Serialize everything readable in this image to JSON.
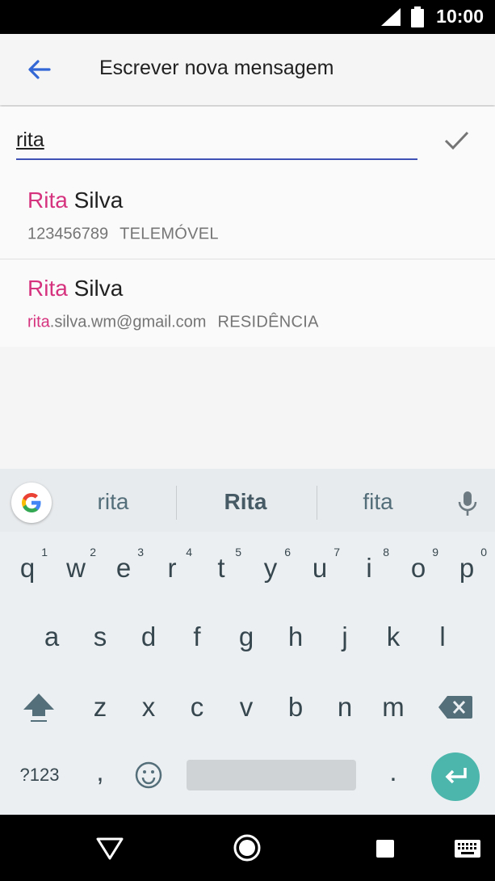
{
  "status": {
    "time": "10:00"
  },
  "app_bar": {
    "title": "Escrever nova mensagem"
  },
  "search": {
    "value": "rita"
  },
  "results": [
    {
      "name_match": "Rita",
      "name_rest": " Silva",
      "detail_match": "",
      "detail_rest": "123456789",
      "type": "TELEMÓVEL"
    },
    {
      "name_match": "Rita",
      "name_rest": " Silva",
      "detail_match": "rita",
      "detail_rest": ".silva.wm@gmail.com",
      "type": "RESIDÊNCIA"
    }
  ],
  "keyboard": {
    "suggestions": [
      "rita",
      "Rita",
      "fita"
    ],
    "row1": [
      "q",
      "w",
      "e",
      "r",
      "t",
      "y",
      "u",
      "i",
      "o",
      "p"
    ],
    "row1_hints": [
      "1",
      "2",
      "3",
      "4",
      "5",
      "6",
      "7",
      "8",
      "9",
      "0"
    ],
    "row2": [
      "a",
      "s",
      "d",
      "f",
      "g",
      "h",
      "j",
      "k",
      "l"
    ],
    "row3": [
      "z",
      "x",
      "c",
      "v",
      "b",
      "n",
      "m"
    ],
    "symbols_label": "?123",
    "comma": ",",
    "period": "."
  },
  "colors": {
    "accent": "#3f51b5",
    "highlight": "#d6337f",
    "enter": "#4db6ac",
    "back_arrow": "#3367d6"
  }
}
